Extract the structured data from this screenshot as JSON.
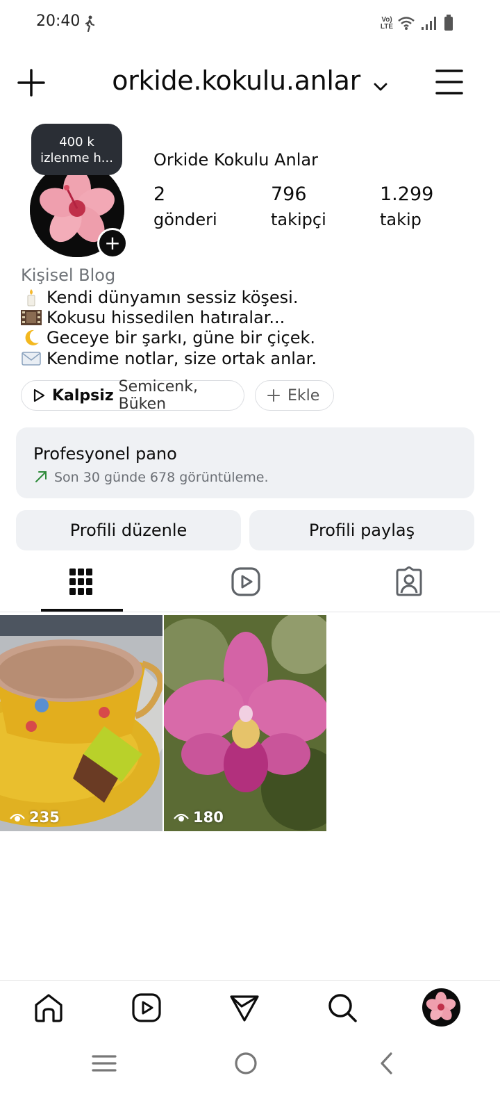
{
  "status_bar": {
    "time": "20:40",
    "network_label": "Vo) LTE"
  },
  "header": {
    "username": "orkide.kokulu.anlar"
  },
  "profile": {
    "note": [
      "400 k",
      "izlenme h..."
    ],
    "display_name": "Orkide Kokulu Anlar",
    "stats": [
      {
        "value": "2",
        "label": "gönderi"
      },
      {
        "value": "796",
        "label": "takipçi"
      },
      {
        "value": "1.299",
        "label": "takip"
      }
    ],
    "category": "Kişisel Blog",
    "bio": [
      "Kendi dünyamın sessiz köşesi.",
      "Kokusu hissedilen hatıralar...",
      "Geceye bir şarkı, güne bir çiçek.",
      "Kendime notlar, size ortak anlar."
    ]
  },
  "music": {
    "song": "Kalpsiz",
    "artists": "Semicenk, Büken"
  },
  "add_button": {
    "label": "Ekle"
  },
  "dashboard": {
    "title": "Profesyonel pano",
    "subtitle": "Son 30 günde 678 görüntüleme."
  },
  "actions": {
    "edit_profile": "Profili düzenle",
    "share_profile": "Profili paylaş"
  },
  "posts": [
    {
      "subject": "turkish-coffee",
      "views": "235"
    },
    {
      "subject": "pink-orchid",
      "views": "180"
    }
  ],
  "colors": {
    "accent_green": "#2e8b3a",
    "card_bg": "#eff1f4"
  }
}
